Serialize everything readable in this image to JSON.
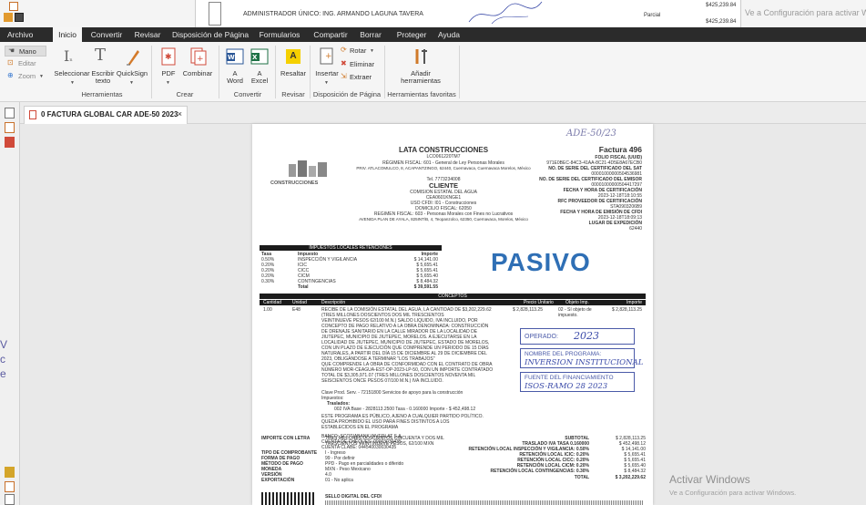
{
  "background_window": {
    "admin_line": "ADMINISTRADOR ÚNICO: ING. ARMANDO LAGUNA TAVERA",
    "parcial_label": "Parcial",
    "amount_top": "$425,239.84",
    "amount_bottom": "$425,239.84",
    "watermark": "Ve a Configuración para activar Window"
  },
  "menu": {
    "tabs": [
      "Archivo",
      "Inicio",
      "Convertir",
      "Revisar",
      "Disposición de Página",
      "Formularios",
      "Compartir",
      "Borrar",
      "Proteger",
      "Ayuda"
    ],
    "active": "Inicio"
  },
  "ribbon": {
    "left_tools": [
      "Mano",
      "Editar",
      "Zoom"
    ],
    "herramientas": {
      "seleccionar": "Seleccionar",
      "escribir": "Escribir texto",
      "escribir_l1": "Escribir",
      "escribir_l2": "texto",
      "quicksign": "QuickSign",
      "group": "Herramientas"
    },
    "crear": {
      "pdf": "PDF",
      "combinar": "Combinar",
      "group": "Crear"
    },
    "convertir": {
      "a_word_l1": "A",
      "a_word_l2": "Word",
      "a_excel_l1": "A",
      "a_excel_l2": "Excel",
      "group": "Convertir"
    },
    "revisar": {
      "resaltar": "Resaltar",
      "group": "Revisar"
    },
    "disposicion": {
      "insertar": "Insertar",
      "rotar": "Rotar",
      "eliminar": "Eliminar",
      "extraer": "Extraer",
      "group": "Disposición de Página"
    },
    "favoritas": {
      "anadir_l1": "Añadir",
      "anadir_l2": "herramientas",
      "group": "Herramientas favoritas"
    }
  },
  "document_tab": {
    "title": "0 FACTURA GLOBAL CAR ADE-50 2023",
    "close": "×"
  },
  "invoice": {
    "handwritten_top": "ADE-50/23",
    "company": "LATA CONSTRUCCIONES",
    "company_rfc": "LCO061220TM7",
    "regimen": "RÉGIMEN FISCAL: 601 - General de Ley Personas Morales",
    "address": "PRIV. ATLACOMULCO, 8, ACAPANTZINGO, 62440, Cuernavaca, Cuernavaca Morelos, México",
    "tel": "Tel. 7773234008",
    "logo_text": "CONSTRUCCIONES",
    "cliente_label": "CLIENTE",
    "cliente_name": "COMISION ESTATAL DEL AGUA",
    "cliente_rfc": "CEA0601KNGE1",
    "uso_cfdi": "USO CFDI: I01 - Construcciones",
    "domicilio": "DOMICILIO FISCAL: 62050",
    "regimen_cliente": "REGIMEN FISCAL: 603 - Personas Morales con Fines no Lucrativos",
    "cliente_address": "AVENIDA PLAN DE AYALA, 825INT/B, 4, Teopanzolco, 62350, Cuernavaca, Morelos, México",
    "factura": "Factura 496",
    "folio_fiscal_label": "FOLIO FISCAL (UUID)",
    "folio_fiscal": "971E0BEC-84C3-41AA-8C21-4D5E8A67ECB0",
    "serie_sat_label": "NO. DE SERIE DEL CERTIFICADO DEL SAT",
    "serie_sat": "00001000000504536981",
    "serie_emisor_label": "NO. DE SERIE DEL CERTIFICADO DEL EMISOR",
    "serie_emisor": "00001000000504417297",
    "fecha_cert_label": "FECHA Y HORA DE CERTIFICACIÓN",
    "fecha_cert": "2023-12-18T18:10:55",
    "rfc_prov_label": "RFC PROVEEDOR DE CERTIFICACIÓN",
    "rfc_prov": "STA0903206B9",
    "fecha_emision_label": "FECHA Y HORA DE EMISIÓN DE CFDI",
    "fecha_emision": "2023-12-18T18:09:13",
    "lugar_label": "LUGAR DE EXPEDICIÓN",
    "lugar": "62440",
    "impuestos_header": "IMPUESTOS LOCALES RETENCIONES",
    "imp_cols": [
      "Tasa",
      "Impuesto",
      "Importe"
    ],
    "imp_rows": [
      [
        "0.50%",
        "INSPECCIÓN Y VIGILANCIA",
        "$ 14,141.00"
      ],
      [
        "0.20%",
        "ICIC",
        "$ 5,655.41"
      ],
      [
        "0.20%",
        "CICC",
        "$ 5,655.41"
      ],
      [
        "0.20%",
        "CICM",
        "$ 5,655.40"
      ],
      [
        "0.30%",
        "CONTINGENCIAS",
        "$ 8,484.32"
      ],
      [
        "",
        "Total",
        "$ 39,591.55"
      ]
    ],
    "stamp_pasivo": "PASIVO",
    "conceptos_header": "CONCEPTOS",
    "concept_cols": [
      "Cantidad",
      "Unidad",
      "Descripción",
      "Precio Unitario",
      "Objeto Imp.",
      "Importe"
    ],
    "concept_qty": "1.00",
    "concept_unit": "E48",
    "concept_price": "$ 2,828,113.25",
    "concept_obj": "02 - Sí objeto de impuesto.",
    "concept_importe": "$ 2,828,113.25",
    "concept_desc": [
      "RECIBE DE LA COMISIÓN ESTATAL DEL AGUA, LA CANTIDAD DE $3,202,229.62",
      "(TRES MILLONES DOSCIENTOS DOS MIL TRESCIENTOS",
      "VEINTINUEVE PESOS 62/100 M.N.) SALDO LIQUIDO, IVA INCLUIDO, POR",
      "CONCEPTO DE PAGO RELATIVO A LA OBRA DENOMINADA: CONSTRUCCIÓN",
      "DE DRENAJE SANITARIO EN LA CALLE MIRADOR DE LA LOCALIDAD DE",
      "JIUTEPEC, MUNICIPIO DE JIUTEPEC, MORELOS. A EJECUTARSE EN LA",
      "LOCALIDAD DE JIUTEPEC, MUNICIPIO DE JIUTEPEC, ESTADO DE MORELOS,",
      "CON UN PLAZO DE EJECUCIÓN QUE COMPRENDE UN PERIODO DE 15 DÍAS",
      "NATURALES, A PARTIR DEL DÍA 15 DE DICIEMBRE AL 29 DE DICIEMBRE DEL",
      "2023, OBLIGÁNDOSE A TERMINAR \"LOS TRABAJOS\"",
      "QUE COMPRENDE LA OBRA DE CONFORMIDAD CON EL CONTRATO DE OBRA",
      "NÚMERO MOR-CEAGUA-EST-OP-2023-LP-50, CON UN IMPORTE CONTRATADO",
      "TOTAL DE $3,305,971.07 (TRES MILLONES DOSCIENTOS NOVENTA MIL",
      "SEISCIENTOS ONCE PESOS 07/100 M.N.) IVA INCLUIDO."
    ],
    "clave_prod": "Clave Prod. Serv. - 72151800 Servicios de apoyo para la construcción",
    "impuestos_label": "Impuestos:",
    "trasladados_label": "Traslados:",
    "traslado_line": "002 IVA Base - 2828113.2500 Tasa - 0.160000 Importe - $ 452,498.12",
    "publico": [
      "ESTE PROGRAMA ES PÚBLICO, AJENO A CUALQUIER PARTIDO POLÍTICO.",
      "QUEDA PROHIBIDO EL USO PARA FINES DISTINTOS A LOS",
      "ESTABLECIDOS EN EL PROGRAMA"
    ],
    "banco": [
      "BANCO: SCOTIABANK INVERLAT S.A.",
      "CUENTA DE CHEQUES: 00003030435",
      "CUENTA CLABE: 044540030030435"
    ],
    "operado_label": "OPERADO:",
    "operado_hand": "2023",
    "programa_label": "NOMBRE DEL PROGRAMA:",
    "programa_hand": "INVERSION INSTITUCIONAL",
    "fuente_label": "FUENTE DEL FINANCIAMIENTO",
    "fuente_hand": "ISOS-RAMO 28 2023",
    "importe_letra_label": "IMPORTE CON LETRA",
    "importe_letra": [
      "TRES MILLONES DOSCIENTOS CINCUENTA Y DOS MIL",
      "TRESCIENTOS VEINTINUEVE PESOS, 62/100 MXN"
    ],
    "fields_left": [
      [
        "TIPO DE COMPROBANTE",
        "I - Ingreso"
      ],
      [
        "FORMA DE PAGO",
        "99 - Por definir"
      ],
      [
        "MÉTODO DE PAGO",
        "PPD - Pago en parcialidades o diferido"
      ],
      [
        "MONEDA",
        "MXN - Peso Mexicano"
      ],
      [
        "VERSIÓN",
        "4.0"
      ],
      [
        "EXPORTACIÓN",
        "01 - No aplica"
      ]
    ],
    "totals": [
      [
        "SUBTOTAL",
        "$ 2,828,113.25"
      ],
      [
        "TRASLADO IVA TASA 0.160000",
        "$ 452,498.12"
      ],
      [
        "RETENCIÓN LOCAL INSPECCIÓN Y VIGILANCIA: 0.50%",
        "$ 14,141.00"
      ],
      [
        "RETENCIÓN LOCAL ICIC: 0.20%",
        "$ 5,655.41"
      ],
      [
        "RETENCIÓN LOCAL CICC: 0.20%",
        "$ 5,655.41"
      ],
      [
        "RETENCIÓN LOCAL CICM: 0.20%",
        "$ 5,655.40"
      ],
      [
        "RETENCIÓN LOCAL CONTINGENCIAS: 0.30%",
        "$ 8,484.32"
      ],
      [
        "TOTAL",
        "$ 3,202,229.62"
      ]
    ],
    "sello_label": "SELLO DIGITAL DEL CFDI"
  },
  "activation": {
    "title": "Activar Windows",
    "subtitle": "Ve a Configuración para activar Windows."
  },
  "left_bleed": [
    "V",
    "c",
    "e"
  ]
}
